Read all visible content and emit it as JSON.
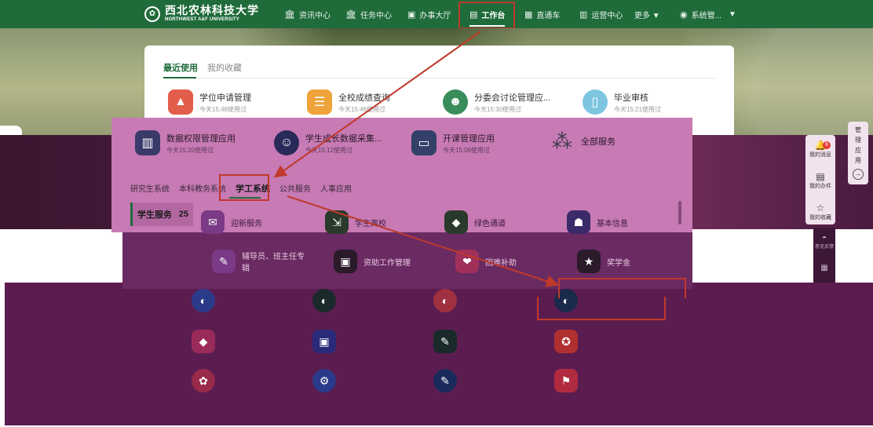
{
  "brand": {
    "name_cn": "西北农林科技大学",
    "name_en": "NORTHWEST A&F UNIVERSITY"
  },
  "nav": [
    {
      "label": "资讯中心",
      "icon": "bank-icon"
    },
    {
      "label": "任务中心",
      "icon": "bank-icon"
    },
    {
      "label": "办事大厅",
      "icon": "hall-icon"
    },
    {
      "label": "工作台",
      "icon": "workbench-icon"
    },
    {
      "label": "直通车",
      "icon": "car-icon"
    },
    {
      "label": "运营中心",
      "icon": "ops-icon"
    },
    {
      "label": "更多 ▼",
      "icon": ""
    },
    {
      "label": "系统管...",
      "icon": "user-icon"
    }
  ],
  "user_menu_caret": "▼",
  "card": {
    "tab_recent": "最近使用",
    "tab_fav": "我的收藏",
    "recent": [
      {
        "name": "学位申请管理",
        "time": "今天15:48使用过",
        "color": "#e35d4b",
        "glyph": "🎓"
      },
      {
        "name": "全校成绩查询",
        "time": "今天15:46使用过",
        "color": "#f0a33a",
        "glyph": "📋"
      },
      {
        "name": "分委会讨论管理应...",
        "time": "今天15:30使用过",
        "color": "#3a8d5b",
        "glyph": "🎓"
      },
      {
        "name": "毕业审核",
        "time": "今天15:21使用过",
        "color": "#7ec6e0",
        "glyph": "📄"
      }
    ],
    "recent2": [
      {
        "name": "数据权限管理应用",
        "time": "今天15:20使用过",
        "color": "#3a3a6a",
        "glyph": "📊"
      },
      {
        "name": "学生成长数据采集...",
        "time": "今天15:12使用过",
        "color": "#2a2a5a",
        "glyph": "👤"
      },
      {
        "name": "开课管理应用",
        "time": "今天15:06使用过",
        "color": "#33406a",
        "glyph": "🖥"
      }
    ],
    "all_services": "全部服务"
  },
  "subtabs": [
    "研究生系统",
    "本科教务系统",
    "学工系统",
    "公共服务",
    "人事应用"
  ],
  "category": {
    "label": "学生服务",
    "count": "25"
  },
  "services_row1": [
    "迎新服务",
    "学生离校",
    "绿色通道",
    "基本信息"
  ],
  "services_row2": [
    "辅导员、班主任专辑",
    "资助工作管理",
    "困难补助",
    "奖学金"
  ],
  "right_tools": {
    "messages": "我的消息",
    "message_count": "8",
    "todos": "我的办件",
    "favorites": "我的收藏",
    "feedback": "意见反馈"
  },
  "manage_app": {
    "label": "管理应用",
    "arrow": "→"
  }
}
